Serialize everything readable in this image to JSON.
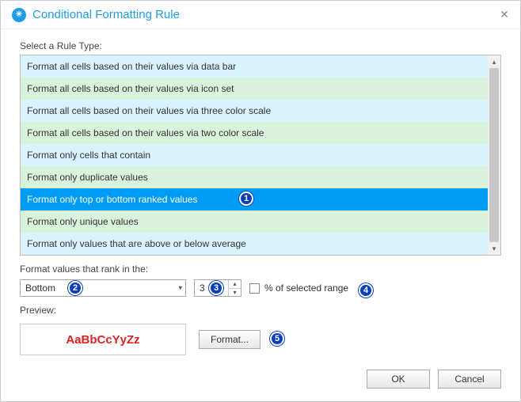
{
  "title": "Conditional Formatting Rule",
  "close_glyph": "✕",
  "select_label": "Select a Rule Type:",
  "rule_types": [
    "Format all cells based on their values via data bar",
    "Format all cells based on their values via icon set",
    "Format all cells based on their values via three color scale",
    "Format all cells based on their values via two color scale",
    "Format only cells that contain",
    "Format only duplicate values",
    "Format only top or bottom ranked values",
    "Format only unique values",
    "Format only values that are above or below average"
  ],
  "selected_index": 6,
  "rank_label": "Format values that rank in the:",
  "rank_direction": "Bottom",
  "rank_value": "3",
  "percent_label": "% of selected range",
  "percent_checked": false,
  "preview_label": "Preview:",
  "preview_sample": "AaBbCcYyZz",
  "format_button": "Format...",
  "ok_button": "OK",
  "cancel_button": "Cancel",
  "badges": [
    "1",
    "2",
    "3",
    "4",
    "5"
  ],
  "scroll_up": "▴",
  "scroll_down": "▾",
  "caret": "▾",
  "spin_up": "▴",
  "spin_down": "▾"
}
